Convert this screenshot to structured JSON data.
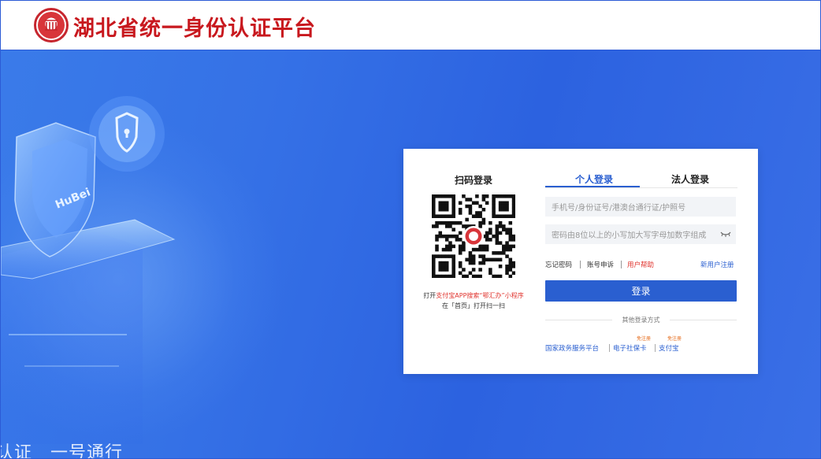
{
  "header": {
    "title": "湖北省统一身份认证平台"
  },
  "background": {
    "slogan": "认证　一号通行",
    "shield_text": "HuBei"
  },
  "login": {
    "qr": {
      "title": "扫码登录",
      "hint_prefix": "打开",
      "hint_highlight": "支付宝APP搜索“鄂汇办”小程序",
      "hint_line2": "在「首页」打开扫一扫"
    },
    "tabs": [
      {
        "label": "个人登录",
        "active": true
      },
      {
        "label": "法人登录",
        "active": false
      }
    ],
    "username": {
      "placeholder": "手机号/身份证号/港澳台通行证/护照号"
    },
    "password": {
      "placeholder": "密码由8位以上的小写加大写字母加数字组成"
    },
    "links": {
      "forgot": "忘记密码",
      "appeal": "账号申诉",
      "help": "用户帮助",
      "register": "新用户注册"
    },
    "submit_label": "登录",
    "other_methods_label": "其他登录方式",
    "alt_logins": [
      {
        "label": "国家政务服务平台",
        "badge": ""
      },
      {
        "label": "电子社保卡",
        "badge": "免注册"
      },
      {
        "label": "支付宝",
        "badge": "免注册"
      }
    ]
  },
  "colors": {
    "brand_red": "#c8181e",
    "primary_blue": "#2a5fd0",
    "background_blue": "#2e62e0",
    "highlight_red": "#e0332d",
    "badge_orange": "#e66b1a"
  }
}
